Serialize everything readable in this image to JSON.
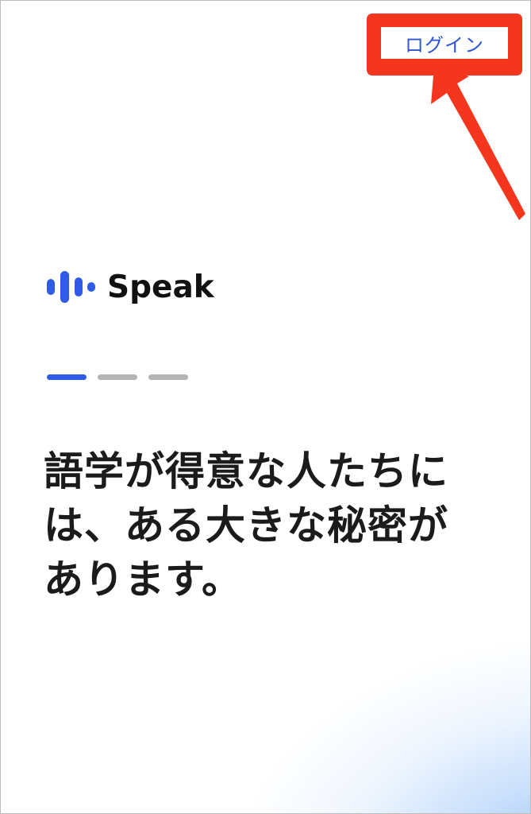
{
  "header": {
    "login_label": "ログイン"
  },
  "brand": {
    "name": "Speak",
    "accent_color": "#2f5be7"
  },
  "pager": {
    "total_pages": 3,
    "current_page": 1
  },
  "onboarding": {
    "headline": "語学が得意な人たちには、ある大きな秘密があります。"
  },
  "annotation": {
    "highlight_color": "#f5361e",
    "icon": "arrow-pointer-icon"
  }
}
